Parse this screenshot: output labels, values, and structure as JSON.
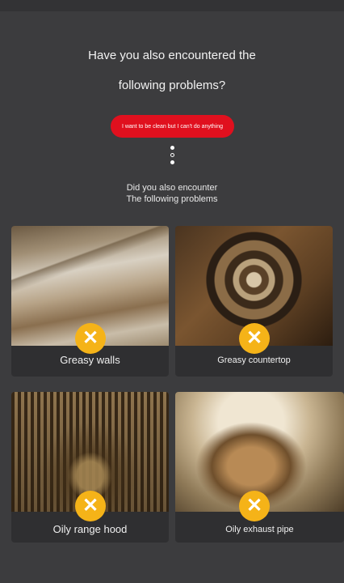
{
  "header": {
    "line1": "Have you also encountered the",
    "line2": "following problems?",
    "pill_text": "I want to be clean but I can't do anything"
  },
  "subheader": {
    "line1": "Did you also encounter",
    "line2": "The following problems"
  },
  "problems": [
    {
      "label": "Greasy walls",
      "badge": "✕"
    },
    {
      "label": "Greasy countertop",
      "badge": "✕"
    },
    {
      "label": "Oily range hood",
      "badge": "✕"
    },
    {
      "label": "Oily exhaust pipe",
      "badge": "✕"
    }
  ],
  "colors": {
    "background": "#3c3c3e",
    "pill": "#e0101e",
    "badge": "#f5b318"
  }
}
